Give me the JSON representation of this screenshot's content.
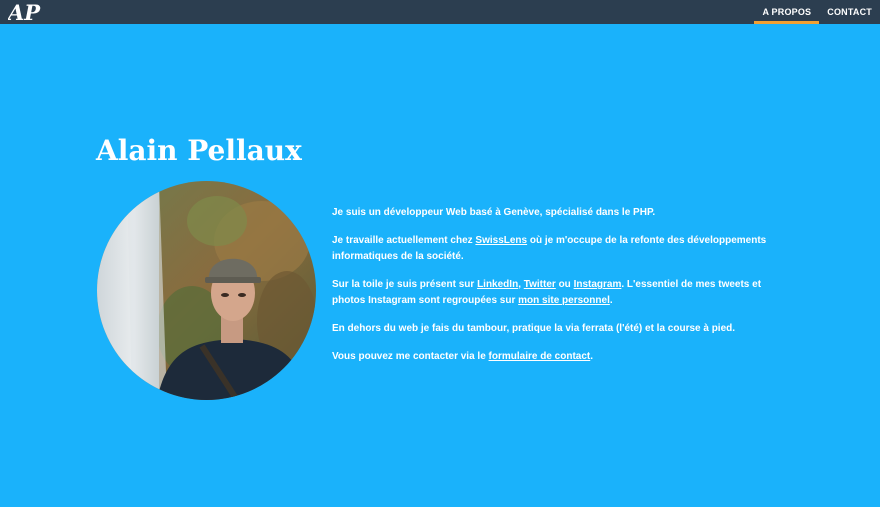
{
  "header": {
    "logo_text": "AP",
    "nav": [
      {
        "label": "A PROPOS",
        "active": true
      },
      {
        "label": "CONTACT",
        "active": false
      }
    ]
  },
  "profile": {
    "name": "Alain Pellaux",
    "photo": "portrait-photo"
  },
  "bio": {
    "p1": "Je suis un développeur Web basé à Genève, spécialisé dans le PHP.",
    "p2_before": "Je travaille actuellement chez ",
    "p2_link": "SwissLens",
    "p2_after": " où je m'occupe de la refonte des développements informatiques de la société.",
    "p3_before": "Sur la toile je suis présent sur ",
    "p3_link1": "LinkedIn",
    "p3_sep1": ", ",
    "p3_link2": "Twitter",
    "p3_sep2": " ou ",
    "p3_link3": "Instagram",
    "p3_mid": ". L'essentiel de mes tweets et photos Instagram sont regroupées sur ",
    "p3_link4": "mon site personnel",
    "p3_end": ".",
    "p4": "En dehors du web je fais du tambour, pratique la via ferrata (l'été) et la course à pied.",
    "p5_before": "Vous pouvez me contacter via le ",
    "p5_link": "formulaire de contact",
    "p5_end": "."
  },
  "colors": {
    "background": "#1ab2fb",
    "topbar": "#2c3e50",
    "nav_active_underline": "#f1a033",
    "text": "#ffffff"
  }
}
